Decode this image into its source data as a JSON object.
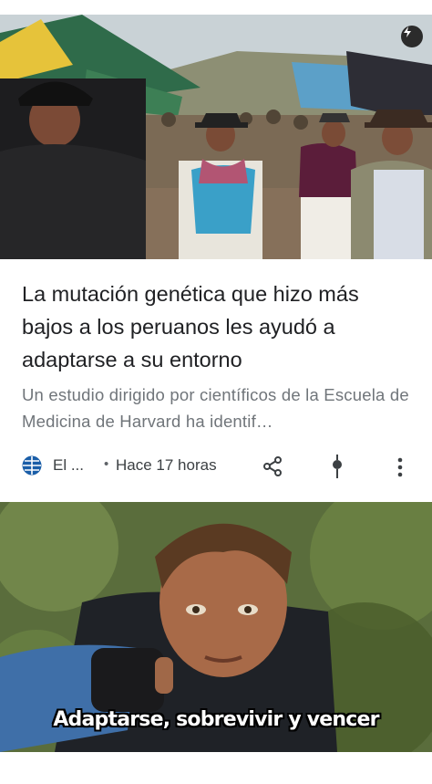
{
  "article": {
    "title": "La mutación genética que hizo más bajos a los peruanos les ayudó a adaptarse a su entorno",
    "snippet": "Un estudio dirigido por científicos de la Escuela de Medicina de Harvard ha identif…",
    "source_name": "El ...",
    "separator": "•",
    "time_ago": "Hace 17 horas",
    "icons": {
      "source": "globe-icon",
      "badge": "amp-lightning-icon",
      "share": "share-icon",
      "pin": "pin-icon",
      "more": "more-vert-icon"
    }
  },
  "meme": {
    "caption": "Adaptarse, sobrevivir y vencer"
  },
  "colors": {
    "title": "#202124",
    "snippet": "#70757a",
    "source_globe": "#1a5ea8"
  }
}
